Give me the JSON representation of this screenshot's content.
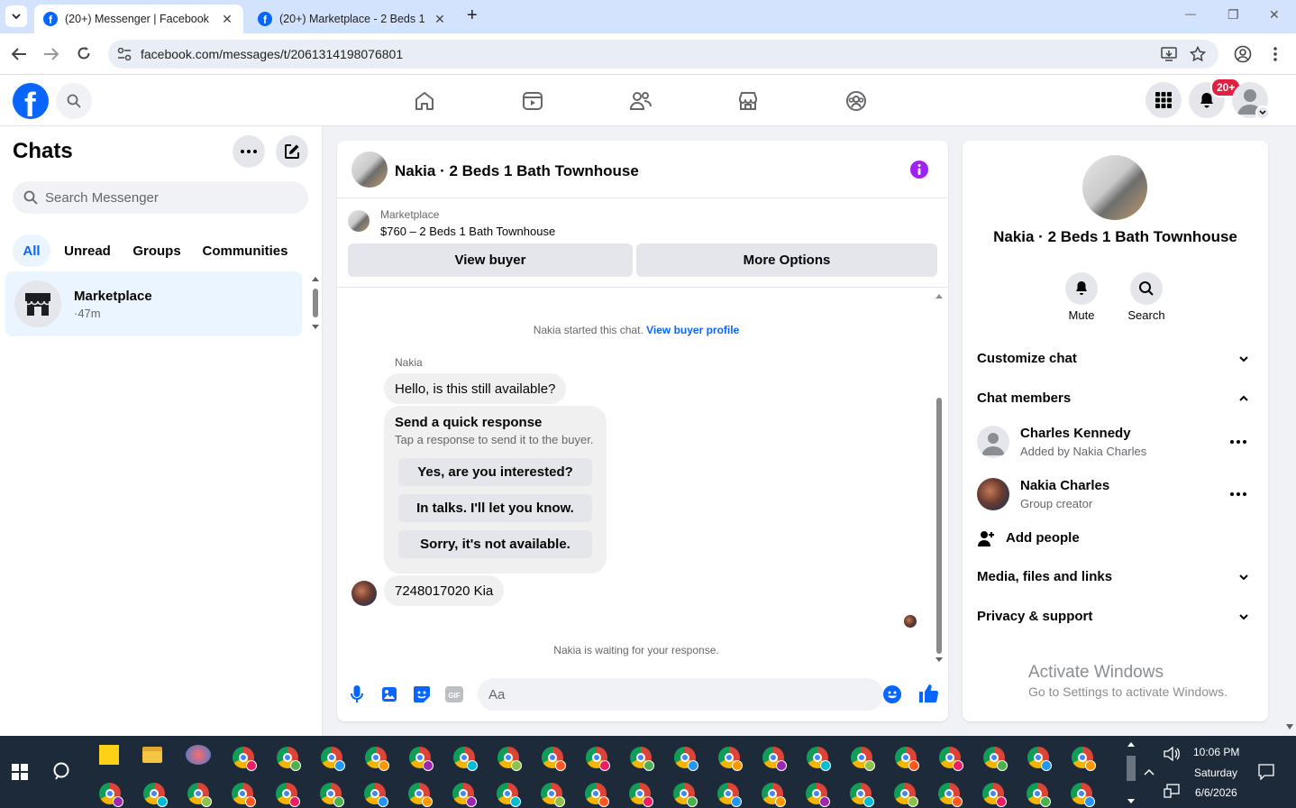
{
  "browser": {
    "tabs": [
      {
        "title": "(20+) Messenger | Facebook",
        "active": true
      },
      {
        "title": "(20+) Marketplace - 2 Beds 1 B",
        "active": false
      }
    ],
    "new_tab": "+",
    "url": "facebook.com/messages/t/2061314198076801",
    "window_controls": {
      "minimize": "—",
      "restore": "❐",
      "close": "✕"
    }
  },
  "fbnav": {
    "logo": "f",
    "notifications_badge": "20+",
    "nav_icons": [
      "home-icon",
      "video-icon",
      "friends-icon",
      "marketplace-icon",
      "groups-icon"
    ]
  },
  "sidebar": {
    "title": "Chats",
    "search_placeholder": "Search Messenger",
    "filters": [
      "All",
      "Unread",
      "Groups",
      "Communities"
    ],
    "chat": {
      "name": "Marketplace",
      "time": "·47m"
    }
  },
  "conversation": {
    "title": "Nakia · 2 Beds 1 Bath Townhouse",
    "listing": {
      "source": "Marketplace",
      "price_title": "$760 – 2 Beds 1 Bath Townhouse"
    },
    "buttons": {
      "view_buyer": "View buyer",
      "more_options": "More Options"
    },
    "started_text": "Nakia started this chat.",
    "view_buyer_profile": "View buyer profile",
    "sender": "Nakia",
    "message_1": "Hello, is this still available?",
    "quick_response": {
      "title": "Send a quick response",
      "subtitle": "Tap a response to send it to the buyer.",
      "options": [
        "Yes, are you interested?",
        "In talks. I'll let you know.",
        "Sorry, it's not available."
      ]
    },
    "message_2": "7248017020 Kia",
    "waiting_text": "Nakia is waiting for your response.",
    "composer_placeholder": "Aa"
  },
  "info_panel": {
    "title": "Nakia · 2 Beds 1 Bath Townhouse",
    "actions": {
      "mute": "Mute",
      "search": "Search"
    },
    "sections": {
      "customize": "Customize chat",
      "members": "Chat members",
      "media": "Media, files and links",
      "privacy": "Privacy & support"
    },
    "members": [
      {
        "name": "Charles Kennedy",
        "sub": "Added by Nakia Charles"
      },
      {
        "name": "Nakia Charles",
        "sub": "Group creator"
      }
    ],
    "add_people": "Add people"
  },
  "watermark": {
    "title": "Activate Windows",
    "sub": "Go to Settings to activate Windows."
  },
  "taskbar": {
    "time": "10:06 PM",
    "day": "Saturday",
    "date": "6/6/2026"
  },
  "colors": {
    "fb_blue": "#0866ff",
    "badge_red": "#e41e3f",
    "info_purple": "#a020f0"
  }
}
